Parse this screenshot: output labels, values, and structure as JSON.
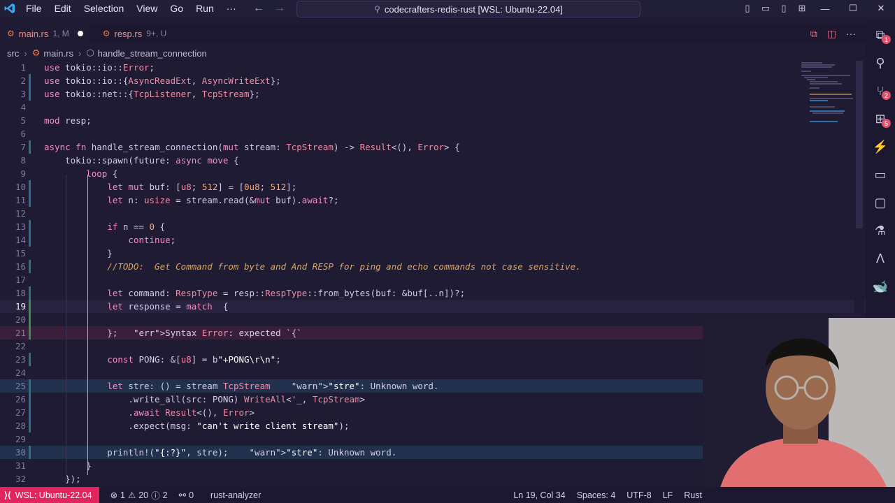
{
  "app": {
    "title": "codecrafters-redis-rust [WSL: Ubuntu-22.04]",
    "menu": [
      "File",
      "Edit",
      "Selection",
      "View",
      "Go",
      "Run",
      "···"
    ]
  },
  "tabs": [
    {
      "name": "main.rs",
      "badge": "1, M",
      "active": true,
      "modified": true
    },
    {
      "name": "resp.rs",
      "badge": "9+, U",
      "active": false,
      "modified": false
    }
  ],
  "breadcrumb": {
    "folder": "src",
    "file": "main.rs",
    "symbol": "handle_stream_connection"
  },
  "code": {
    "current_line": 19,
    "lines": [
      {
        "n": 1,
        "t": "use tokio::io::Error;"
      },
      {
        "n": 2,
        "t": "use tokio::io::{AsyncReadExt, AsyncWriteExt};"
      },
      {
        "n": 3,
        "t": "use tokio::net::{TcpListener, TcpStream};"
      },
      {
        "n": 4,
        "t": ""
      },
      {
        "n": 5,
        "t": "mod resp;"
      },
      {
        "n": 6,
        "t": ""
      },
      {
        "n": 7,
        "t": "async fn handle_stream_connection(mut stream: TcpStream) -> Result<(), Error> {"
      },
      {
        "n": 8,
        "t": "    tokio::spawn(future: async move {"
      },
      {
        "n": 9,
        "t": "        loop {"
      },
      {
        "n": 10,
        "t": "            let mut buf: [u8; 512] = [0u8; 512];"
      },
      {
        "n": 11,
        "t": "            let n: usize = stream.read(&mut buf).await?;"
      },
      {
        "n": 12,
        "t": ""
      },
      {
        "n": 13,
        "t": "            if n == 0 {"
      },
      {
        "n": 14,
        "t": "                continue;"
      },
      {
        "n": 15,
        "t": "            }"
      },
      {
        "n": 16,
        "t": "            //TODO:  Get Command from byte and And RESP for ping and echo commands not case sensitive."
      },
      {
        "n": 17,
        "t": ""
      },
      {
        "n": 18,
        "t": "            let command: RespType = resp::RespType::from_bytes(buf: &buf[..n])?;"
      },
      {
        "n": 19,
        "t": "            let response = match  {"
      },
      {
        "n": 20,
        "t": ""
      },
      {
        "n": 21,
        "t": "            };   Syntax Error: expected `{`"
      },
      {
        "n": 22,
        "t": ""
      },
      {
        "n": 23,
        "t": "            const PONG: &[u8] = b\"+PONG\\r\\n\";"
      },
      {
        "n": 24,
        "t": ""
      },
      {
        "n": 25,
        "t": "            let stre: () = stream TcpStream    \"stre\": Unknown word."
      },
      {
        "n": 26,
        "t": "                .write_all(src: PONG) WriteAll<'_, TcpStream>"
      },
      {
        "n": 27,
        "t": "                .await Result<(), Error>"
      },
      {
        "n": 28,
        "t": "                .expect(msg: \"can't write client stream\");"
      },
      {
        "n": 29,
        "t": ""
      },
      {
        "n": 30,
        "t": "            println!(\"{:?}\", stre);    \"stre\": Unknown word."
      },
      {
        "n": 31,
        "t": "        }"
      },
      {
        "n": 32,
        "t": "    });"
      }
    ]
  },
  "status": {
    "remote": "WSL: Ubuntu-22.04",
    "errors": "1",
    "warnings": "20",
    "infos": "2",
    "ports": "0",
    "analyzer": "rust-analyzer",
    "position": "Ln 19, Col 34",
    "spaces": "Spaces: 4",
    "encoding": "UTF-8",
    "eol": "LF",
    "language": "Rust"
  },
  "activity_badges": {
    "explorer": "1",
    "scm": "2",
    "extensions": "5"
  },
  "colors": {
    "accent": "#e2245f",
    "background": "#1e1b33",
    "keyword": "#f58fc8",
    "comment": "#e0a458"
  }
}
